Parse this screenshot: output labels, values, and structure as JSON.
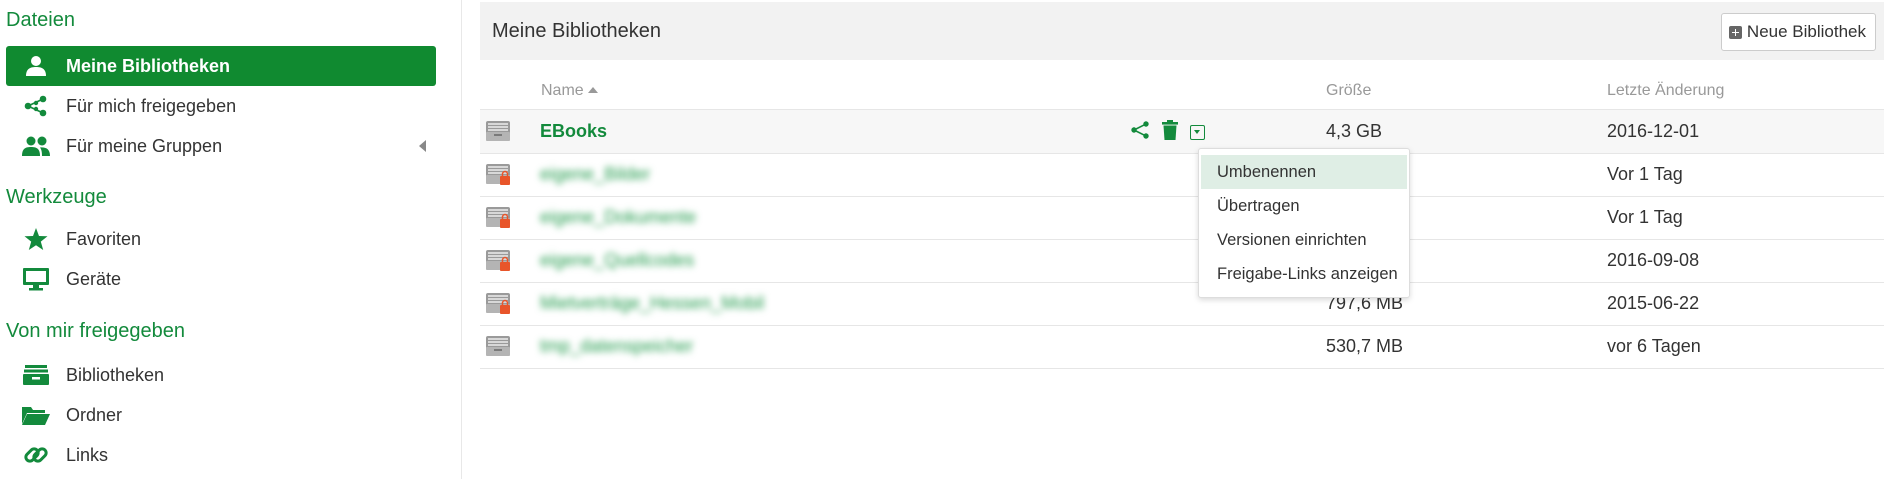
{
  "sidebar": {
    "sections": {
      "files": "Dateien",
      "tools": "Werkzeuge",
      "shared_by_me": "Von mir freigegeben"
    },
    "items": [
      {
        "label": "Meine Bibliotheken",
        "icon": "user-icon"
      },
      {
        "label": "Für mich freigegeben",
        "icon": "share-icon"
      },
      {
        "label": "Für meine Gruppen",
        "icon": "group-icon"
      },
      {
        "label": "Favoriten",
        "icon": "star-icon"
      },
      {
        "label": "Geräte",
        "icon": "monitor-icon"
      },
      {
        "label": "Bibliotheken",
        "icon": "library-icon"
      },
      {
        "label": "Ordner",
        "icon": "folder-icon"
      },
      {
        "label": "Links",
        "icon": "link-icon"
      }
    ]
  },
  "main": {
    "title": "Meine Bibliotheken",
    "new_library_label": "Neue Bibliothek",
    "columns": {
      "name": "Name",
      "size": "Größe",
      "modified": "Letzte Änderung"
    },
    "rows": [
      {
        "name": "EBooks",
        "size": "4,3 GB",
        "modified": "2016-12-01",
        "encrypted": false
      },
      {
        "name": "eigene_Bilder",
        "size": "",
        "modified": "Vor 1 Tag",
        "encrypted": true
      },
      {
        "name": "eigene_Dokumente",
        "size": "",
        "modified": "Vor 1 Tag",
        "encrypted": true
      },
      {
        "name": "eigene_Quellcodes",
        "size": "",
        "modified": "2016-09-08",
        "encrypted": true
      },
      {
        "name": "Mietverträge_Hessen_Mobil",
        "size": "797,6 MB",
        "modified": "2015-06-22",
        "encrypted": true
      },
      {
        "name": "tmp_datenspeicher",
        "size": "530,7 MB",
        "modified": "vor 6 Tagen",
        "encrypted": false
      }
    ],
    "row_menu": [
      "Umbenennen",
      "Übertragen",
      "Versionen einrichten",
      "Freigabe-Links anzeigen"
    ]
  },
  "colors": {
    "accent": "#138a3c",
    "active_bg": "#108a30",
    "lock": "#e8552a"
  }
}
